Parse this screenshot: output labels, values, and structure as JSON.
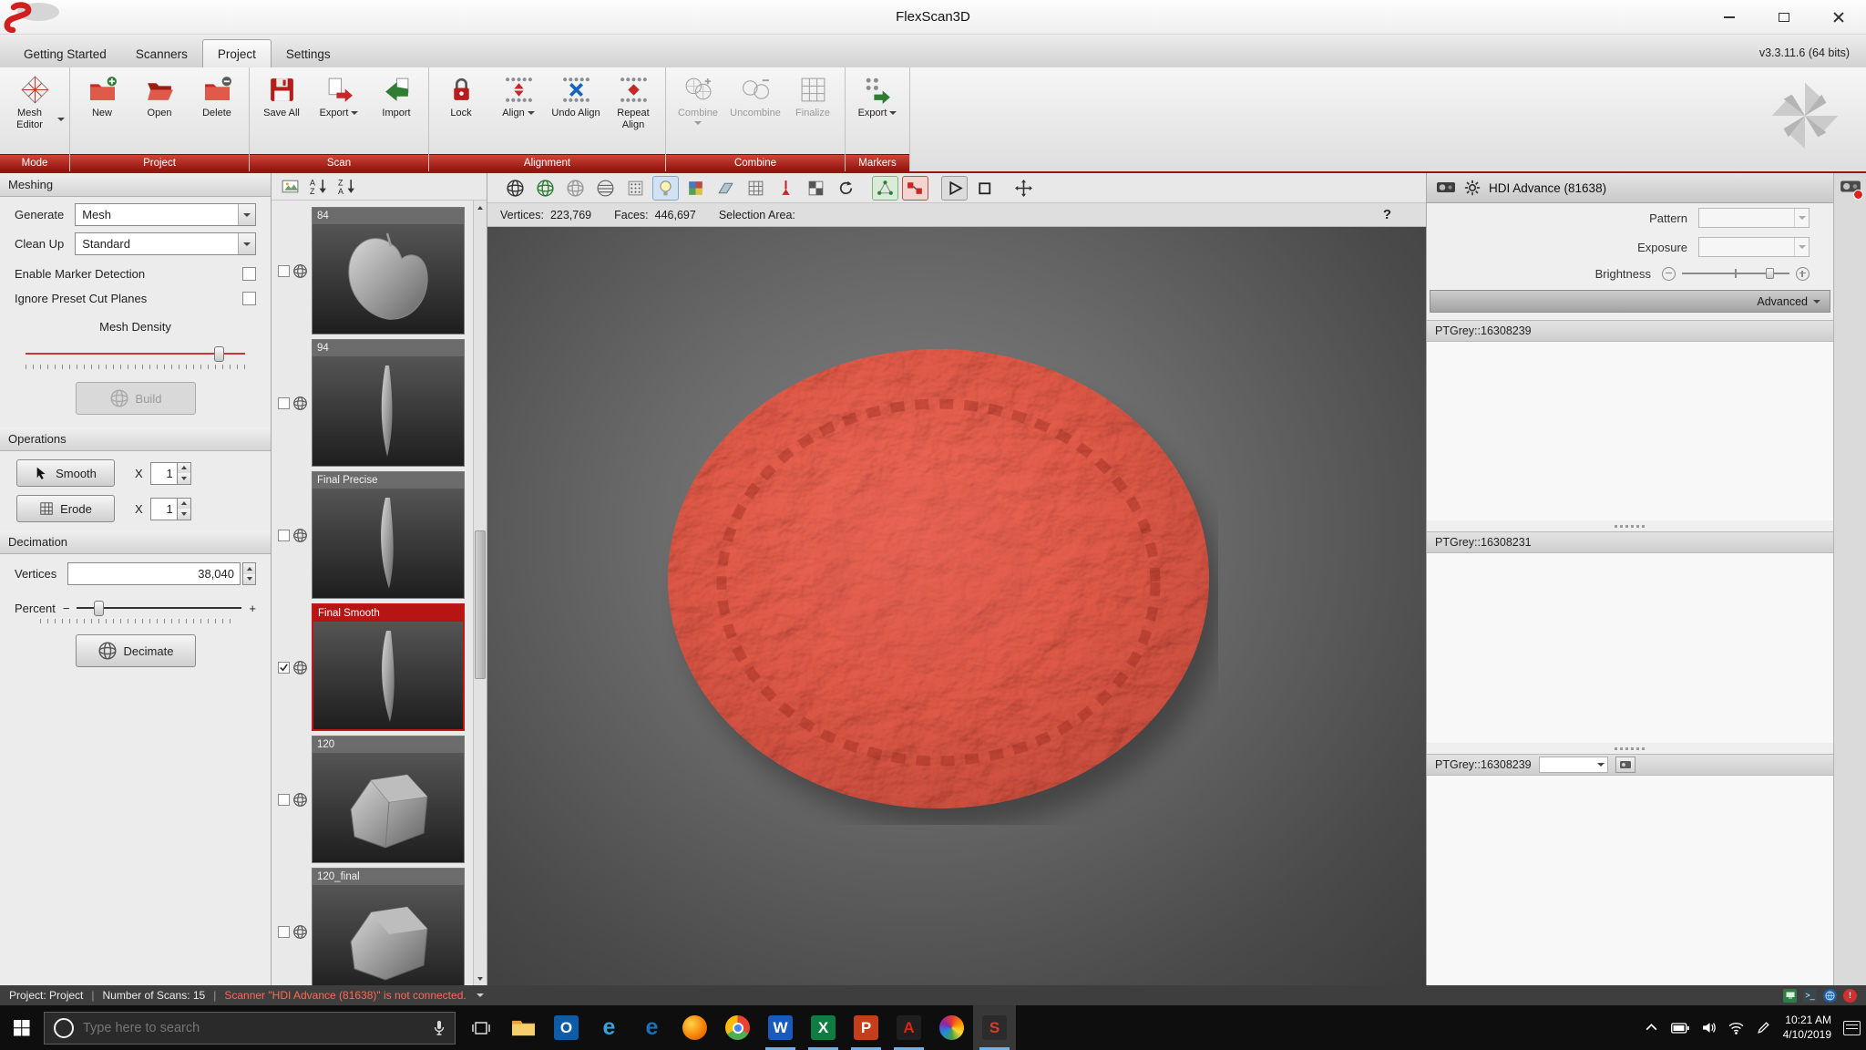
{
  "window": {
    "title": "FlexScan3D",
    "version": "v3.3.11.6  (64 bits)"
  },
  "menu": {
    "items": [
      "Getting Started",
      "Scanners",
      "Project",
      "Settings"
    ]
  },
  "ribbon": {
    "groups": [
      "Mode",
      "Project",
      "Scan",
      "Alignment",
      "Combine",
      "Markers"
    ],
    "mesh_editor": "Mesh Editor",
    "new": "New",
    "open": "Open",
    "delete": "Delete",
    "save_all": "Save All",
    "export_scan": "Export",
    "import": "Import",
    "lock": "Lock",
    "align": "Align",
    "undo_align": "Undo Align",
    "repeat_align": "Repeat Align",
    "combine": "Combine",
    "uncombine": "Uncombine",
    "finalize": "Finalize",
    "export_markers": "Export"
  },
  "meshing": {
    "title": "Meshing",
    "generate": "Generate",
    "generate_value": "Mesh",
    "cleanup": "Clean Up",
    "cleanup_value": "Standard",
    "marker_detection": "Enable Marker Detection",
    "cut_planes": "Ignore Preset Cut Planes",
    "density": "Mesh Density",
    "build": "Build",
    "operations": "Operations",
    "smooth": "Smooth",
    "erode": "Erode",
    "x": "X",
    "smooth_count": "1",
    "erode_count": "1",
    "decimation": "Decimation",
    "vertices": "Vertices",
    "vertices_value": "38,040",
    "percent": "Percent",
    "minus": "−",
    "plus": "+",
    "decimate": "Decimate"
  },
  "scans": {
    "items": [
      "84",
      "94",
      "Final Precise",
      "Final Smooth",
      "120",
      "120_final"
    ]
  },
  "viewport": {
    "vertices_label": "Vertices:",
    "vertices": "223,769",
    "faces_label": "Faces:",
    "faces": "446,697",
    "selection_label": "Selection Area:",
    "help": "?"
  },
  "hdi": {
    "title": "HDI Advance (81638)",
    "pattern": "Pattern",
    "exposure": "Exposure",
    "brightness": "Brightness",
    "advanced": "Advanced",
    "cam1": "PTGrey::16308239",
    "cam2": "PTGrey::16308231",
    "cam3": "PTGrey::16308239"
  },
  "status": {
    "project": "Project:  Project",
    "scans": "Number of Scans:  15",
    "warning": "Scanner \"HDI Advance (81638)\" is not connected.",
    "sep": "|"
  },
  "taskbar": {
    "search": "Type here to search",
    "time": "10:21 AM",
    "date": "4/10/2019",
    "letters": {
      "outlook": "O",
      "edge": "e",
      "ie": "e",
      "word": "W",
      "excel": "X",
      "powerpoint": "P",
      "acrobat": "A",
      "flexscan": "S"
    }
  }
}
